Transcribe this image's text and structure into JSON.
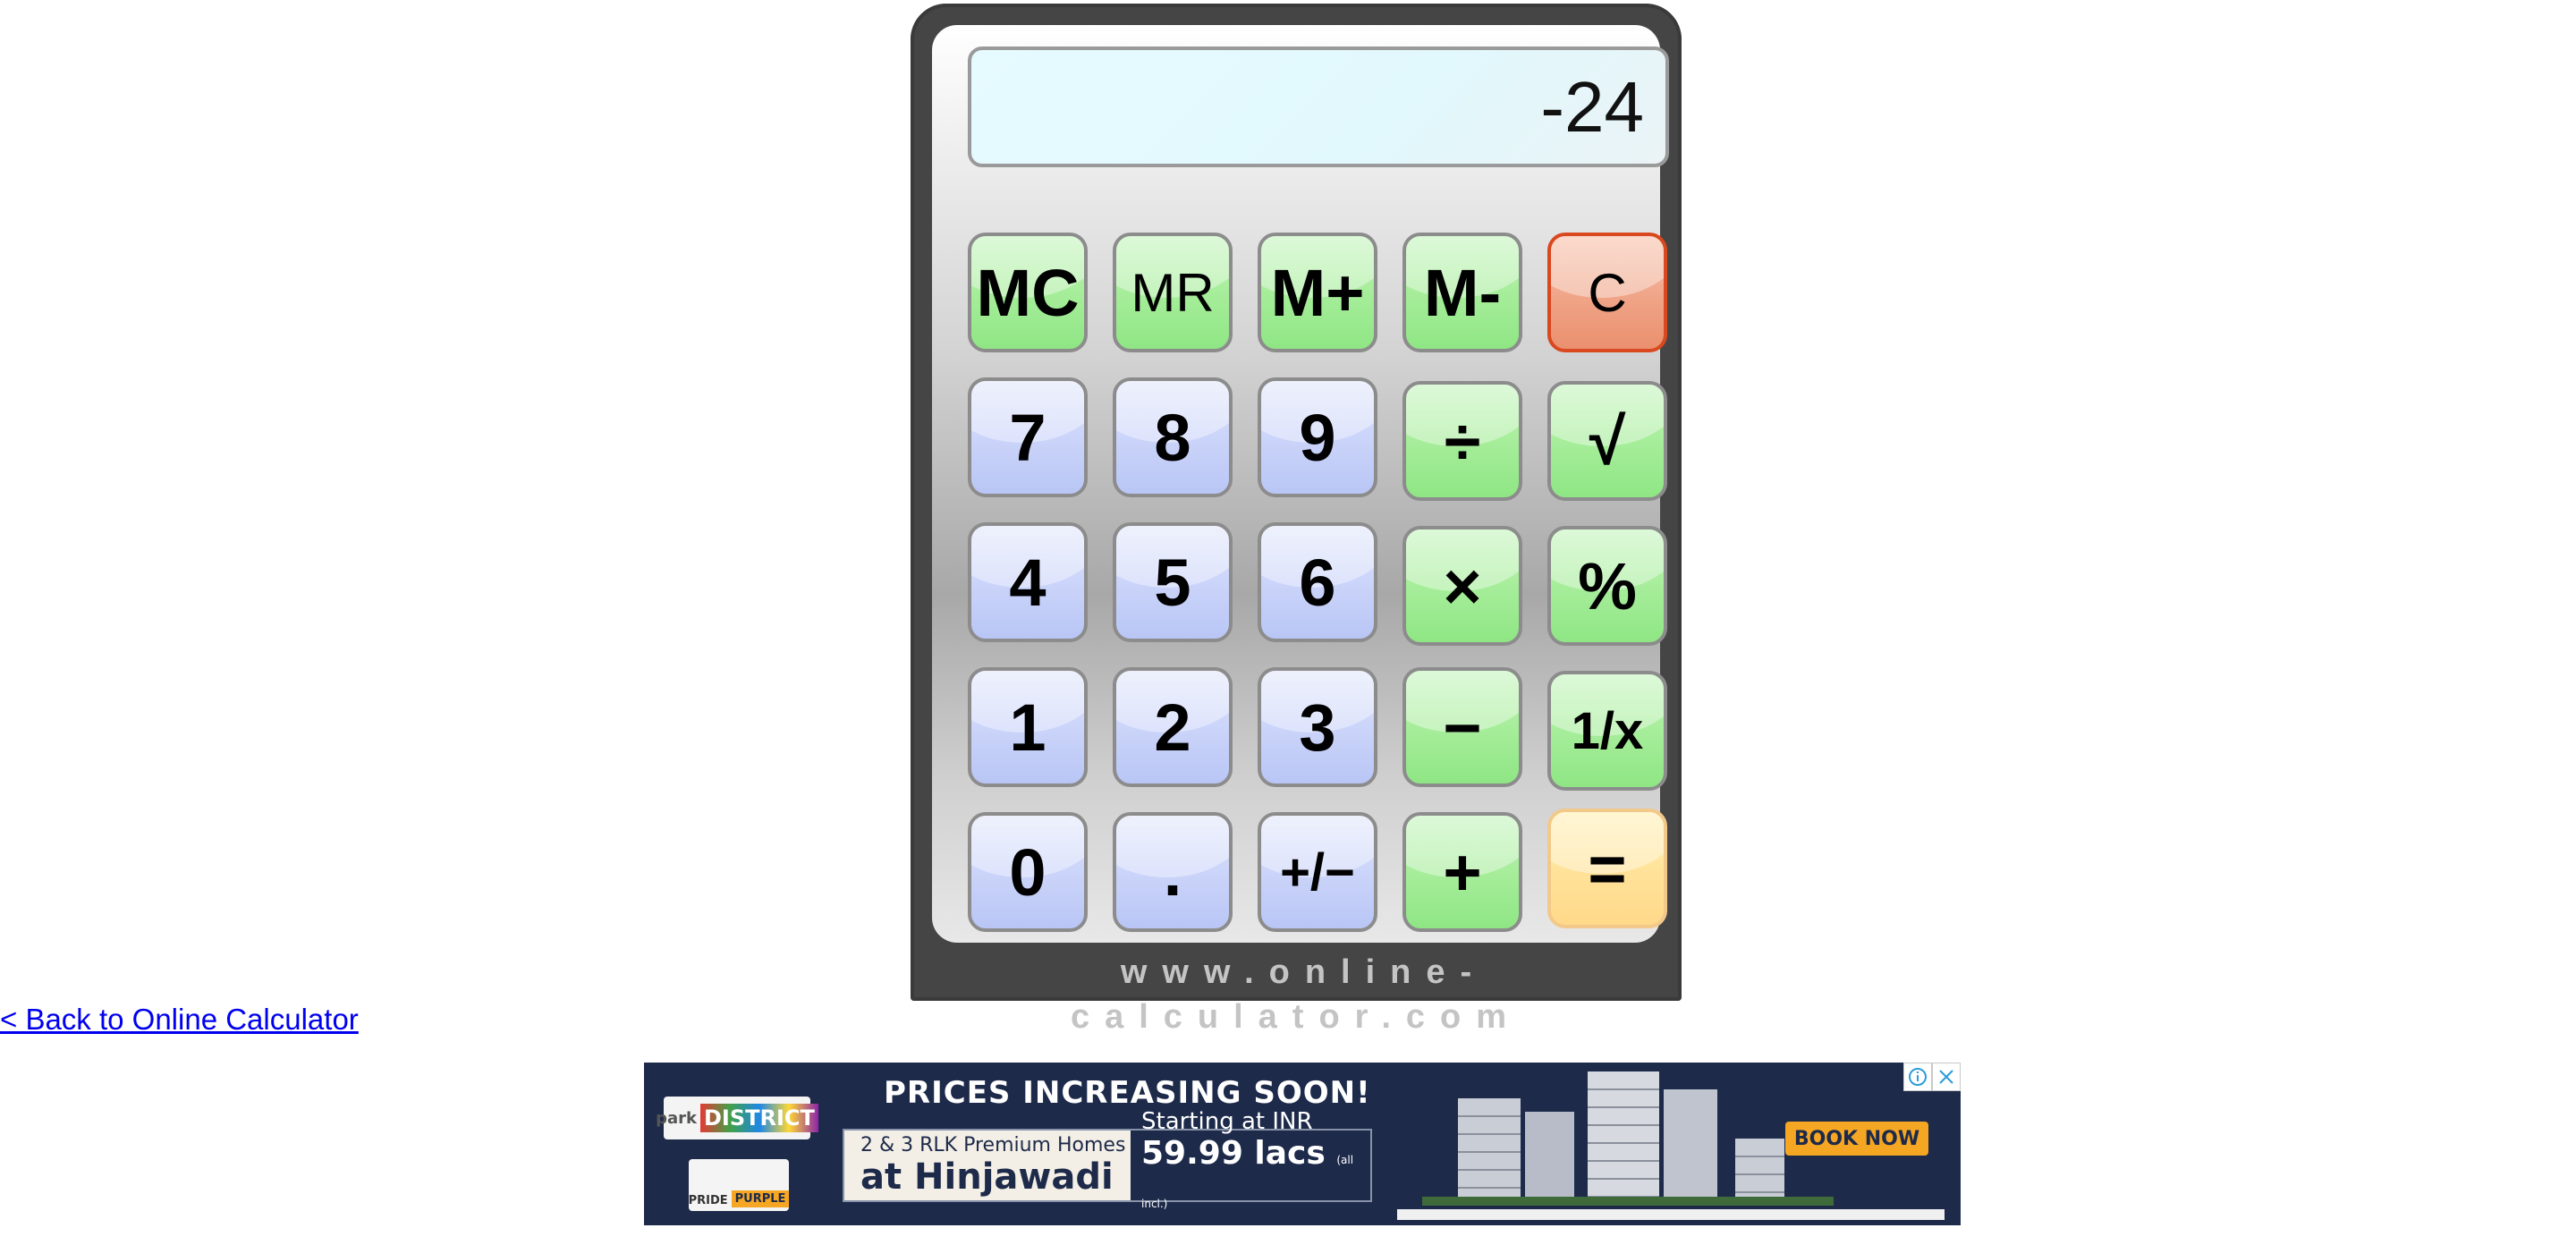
{
  "display": {
    "value": "-24"
  },
  "keys": {
    "mc": "MC",
    "mr": "MR",
    "m_plus": "M+",
    "m_minus": "M-",
    "clear": "C",
    "seven": "7",
    "eight": "8",
    "nine": "9",
    "divide": "÷",
    "sqrt": "√",
    "four": "4",
    "five": "5",
    "six": "6",
    "multiply": "×",
    "percent": "%",
    "one": "1",
    "two": "2",
    "three": "3",
    "minus": "−",
    "reciprocal": "1/x",
    "zero": "0",
    "decimal": ".",
    "plus_minus": "+/−",
    "plus": "+",
    "equals": "="
  },
  "calculator": {
    "brand": "www.online-calculator.com"
  },
  "back_link": {
    "label": "< Back to Online Calculator"
  },
  "ad": {
    "logo_top_park": "park",
    "logo_top_district": "DISTRICT",
    "logo_bottom_pride": "PRIDE",
    "logo_bottom_purple": "PURPLE",
    "headline": "PRICES INCREASING SOON!",
    "box_line1": "2 & 3 RLK Premium Homes",
    "box_line2": "at Hinjawadi",
    "price_line1": "Starting at INR",
    "price_value": "59.99 lacs",
    "price_note": "(all incl.)",
    "cta": "BOOK NOW",
    "info_icon": "info-icon",
    "close_icon": "close-icon",
    "colors": {
      "background": "#1d2a4a",
      "cta": "#f5a623"
    }
  },
  "colors": {
    "key_green": "#a9ee9d",
    "key_blue": "#cdd6fa",
    "key_red": "#f0a487",
    "key_yellow": "#ffe39a",
    "display_bg": "#e1f8fc",
    "body": "#454545",
    "link": "#0000ee"
  }
}
